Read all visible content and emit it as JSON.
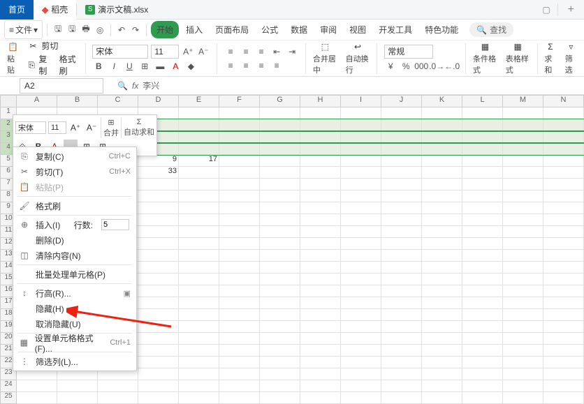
{
  "tabs": {
    "home": "首页",
    "docker": "稻壳",
    "doc": "演示文稿.xlsx"
  },
  "menu": {
    "file": "文件",
    "start": "开始",
    "insert": "插入",
    "layout": "页面布局",
    "formula": "公式",
    "data": "数据",
    "review": "审阅",
    "view": "视图",
    "dev": "开发工具",
    "special": "特色功能",
    "search": "查找"
  },
  "ribbon": {
    "paste": "粘贴",
    "cut": "剪切",
    "copy": "复制",
    "fmtpaint": "格式刷",
    "font": "宋体",
    "size": "11",
    "merge": "合并居中",
    "wrap": "自动换行",
    "numfmt": "常规",
    "condfmt": "条件格式",
    "tblstyle": "表格样式",
    "sum": "求和",
    "filter": "筛选"
  },
  "namebox": "A2",
  "formula": "李兴",
  "columns": [
    "A",
    "B",
    "C",
    "D",
    "E",
    "F",
    "G",
    "H",
    "I",
    "J",
    "K",
    "L",
    "M",
    "N"
  ],
  "rows": [
    "1",
    "2",
    "3",
    "4",
    "5",
    "6",
    "7",
    "8",
    "9",
    "10",
    "11",
    "12",
    "13",
    "14",
    "15",
    "16",
    "17",
    "18",
    "19",
    "20",
    "21",
    "22",
    "23",
    "24",
    "25"
  ],
  "griddata": {
    "r5": [
      "",
      "",
      "",
      "9",
      "17"
    ],
    "r6": [
      "",
      "",
      "",
      "33",
      ""
    ]
  },
  "minibar": {
    "font": "宋体",
    "size": "11",
    "merge": "合并",
    "sum": "自动求和"
  },
  "ctx": {
    "copy": "复制(C)",
    "copy_sc": "Ctrl+C",
    "cut": "剪切(T)",
    "cut_sc": "Ctrl+X",
    "paste": "粘贴(P)",
    "fmt": "格式刷",
    "insert": "插入(I)",
    "insert_lbl": "行数:",
    "insert_n": "5",
    "delete": "删除(D)",
    "clear": "清除内容(N)",
    "batch": "批量处理单元格(P)",
    "rowh": "行高(R)...",
    "hide": "隐藏(H)",
    "unhide": "取消隐藏(U)",
    "cellfmt": "设置单元格格式(F)...",
    "cellfmt_sc": "Ctrl+1",
    "filter": "筛选列(L)..."
  }
}
